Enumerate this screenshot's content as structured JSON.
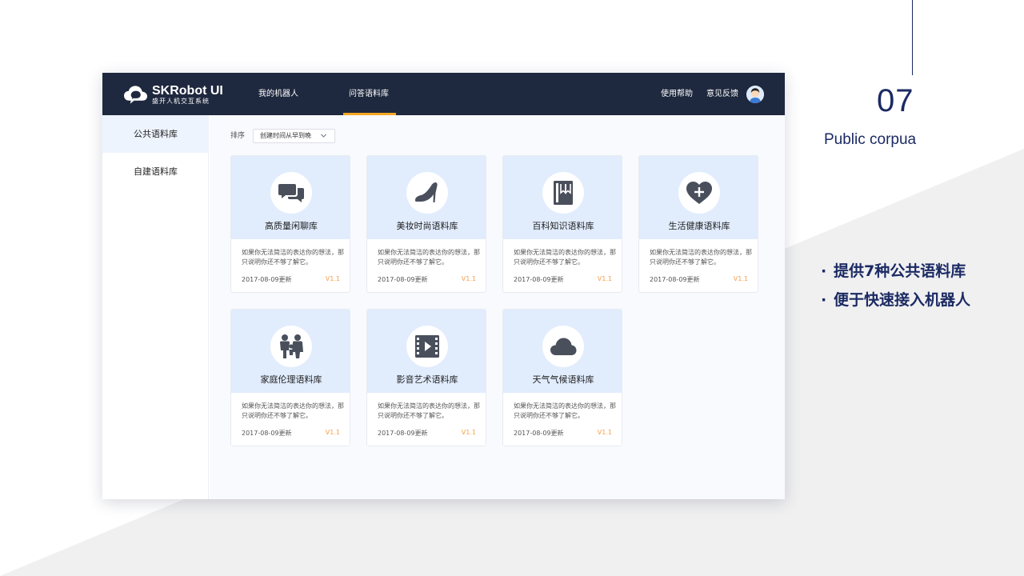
{
  "slide": {
    "number": "07",
    "subtitle": "Public corpua",
    "bullets": [
      {
        "dot": "·",
        "text": "提供7种公共语料库"
      },
      {
        "dot": "·",
        "text": "便于快速接入机器人"
      }
    ],
    "colors": {
      "accent": "#1b2a63",
      "background_shape": "#f0f0f1"
    }
  },
  "app": {
    "logo": {
      "name": "SKRobot UI",
      "tagline": "盛开人机交互系统",
      "icon": "cloud-chat-logo-icon"
    },
    "nav": {
      "items": [
        {
          "label": "我的机器人",
          "active": false
        },
        {
          "label": "问答语料库",
          "active": true
        }
      ],
      "help": "使用帮助",
      "feedback": "意见反馈",
      "avatar_icon": "user-avatar-icon"
    },
    "sidebar": {
      "items": [
        {
          "label": "公共语料库",
          "active": true
        },
        {
          "label": "自建语料库",
          "active": false
        }
      ]
    },
    "sort": {
      "label": "排序",
      "value": "创建时间从早到晚"
    },
    "cards": [
      {
        "title": "高质量闲聊库",
        "icon": "chat-bubbles-icon",
        "desc": "如果你无法简洁的表达你的想法，那只说明你还不够了解它。",
        "date": "2017-08-09更新",
        "version": "V1.1"
      },
      {
        "title": "美妆时尚语料库",
        "icon": "high-heel-icon",
        "desc": "如果你无法简洁的表达你的想法，那只说明你还不够了解它。",
        "date": "2017-08-09更新",
        "version": "V1.1"
      },
      {
        "title": "百科知识语料库",
        "icon": "book-icon",
        "desc": "如果你无法简洁的表达你的想法，那只说明你还不够了解它。",
        "date": "2017-08-09更新",
        "version": "V1.1"
      },
      {
        "title": "生活健康语料库",
        "icon": "heart-plus-icon",
        "desc": "如果你无法简洁的表达你的想法，那只说明你还不够了解它。",
        "date": "2017-08-09更新",
        "version": "V1.1"
      },
      {
        "title": "家庭伦理语料库",
        "icon": "family-icon",
        "desc": "如果你无法简洁的表达你的想法，那只说明你还不够了解它。",
        "date": "2017-08-09更新",
        "version": "V1.1"
      },
      {
        "title": "影音艺术语料库",
        "icon": "film-play-icon",
        "desc": "如果你无法简洁的表达你的想法，那只说明你还不够了解它。",
        "date": "2017-08-09更新",
        "version": "V1.1"
      },
      {
        "title": "天气气候语料库",
        "icon": "cloud-icon",
        "desc": "如果你无法简洁的表达你的想法，那只说明你还不够了解它。",
        "date": "2017-08-09更新",
        "version": "V1.1"
      }
    ],
    "colors": {
      "topbar": "#1e283e",
      "active_underline": "#f5a623",
      "card_header": "#e1ecfd",
      "version": "#f5a14a",
      "icon": "#4a4f5c"
    }
  }
}
